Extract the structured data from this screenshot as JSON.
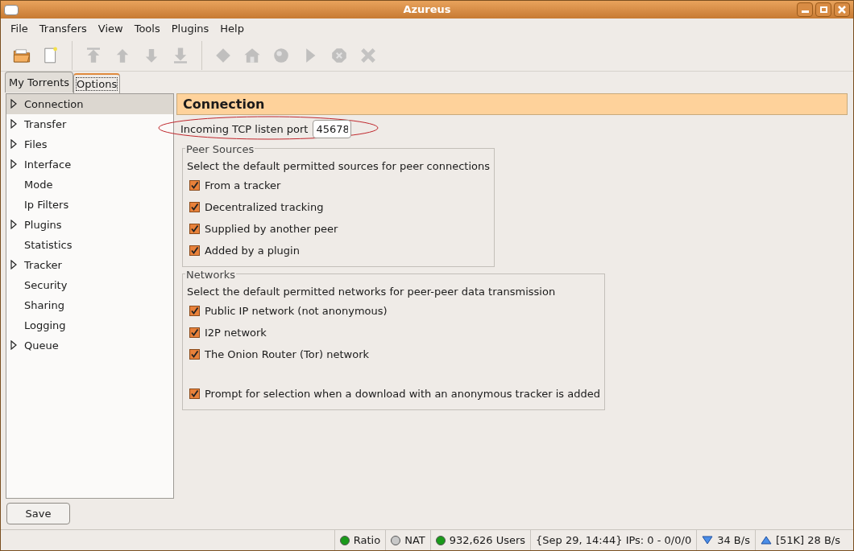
{
  "window": {
    "title": "Azureus"
  },
  "menu": [
    "File",
    "Transfers",
    "View",
    "Tools",
    "Plugins",
    "Help"
  ],
  "toolbar": [
    {
      "kind": "open",
      "disabled": false
    },
    {
      "kind": "new",
      "disabled": false
    },
    {
      "kind": "sep"
    },
    {
      "kind": "top",
      "disabled": true
    },
    {
      "kind": "up",
      "disabled": true
    },
    {
      "kind": "down",
      "disabled": true
    },
    {
      "kind": "bottom",
      "disabled": true
    },
    {
      "kind": "sep"
    },
    {
      "kind": "diamond",
      "disabled": true
    },
    {
      "kind": "house",
      "disabled": true
    },
    {
      "kind": "globe",
      "disabled": true
    },
    {
      "kind": "play",
      "disabled": true
    },
    {
      "kind": "stop",
      "disabled": true
    },
    {
      "kind": "remove",
      "disabled": true
    }
  ],
  "tabs": [
    {
      "label": "My Torrents",
      "selected": false
    },
    {
      "label": "Options",
      "selected": true
    }
  ],
  "sidebar": {
    "items": [
      {
        "label": "Connection",
        "expandable": true,
        "selected": true
      },
      {
        "label": "Transfer",
        "expandable": true,
        "selected": false
      },
      {
        "label": "Files",
        "expandable": true,
        "selected": false
      },
      {
        "label": "Interface",
        "expandable": true,
        "selected": false
      },
      {
        "label": "Mode",
        "expandable": false,
        "selected": false
      },
      {
        "label": "Ip Filters",
        "expandable": false,
        "selected": false
      },
      {
        "label": "Plugins",
        "expandable": true,
        "selected": false
      },
      {
        "label": "Statistics",
        "expandable": false,
        "selected": false
      },
      {
        "label": "Tracker",
        "expandable": true,
        "selected": false
      },
      {
        "label": "Security",
        "expandable": false,
        "selected": false
      },
      {
        "label": "Sharing",
        "expandable": false,
        "selected": false
      },
      {
        "label": "Logging",
        "expandable": false,
        "selected": false
      },
      {
        "label": "Queue",
        "expandable": true,
        "selected": false
      }
    ]
  },
  "panel": {
    "title": "Connection",
    "port": {
      "label": "Incoming TCP listen port",
      "value": "45678"
    },
    "groups": [
      {
        "title": "Peer Sources",
        "description": "Select the default permitted sources for peer connections",
        "options": [
          {
            "kind": "checkbox",
            "label": "From a tracker",
            "checked": true
          },
          {
            "kind": "checkbox",
            "label": "Decentralized tracking",
            "checked": true
          },
          {
            "kind": "checkbox",
            "label": "Supplied by another peer",
            "checked": true
          },
          {
            "kind": "checkbox",
            "label": "Added by a plugin",
            "checked": true
          }
        ]
      },
      {
        "title": "Networks",
        "description": "Select the default permitted networks for peer-peer data transmission",
        "options": [
          {
            "kind": "checkbox",
            "label": "Public IP network (not anonymous)",
            "checked": true
          },
          {
            "kind": "checkbox",
            "label": "I2P network",
            "checked": true
          },
          {
            "kind": "checkbox",
            "label": "The Onion Router (Tor) network",
            "checked": true
          },
          {
            "kind": "spacer"
          },
          {
            "kind": "checkbox",
            "label": "Prompt for selection when a download with an anonymous tracker is added",
            "checked": true
          }
        ]
      }
    ]
  },
  "save_button": "Save",
  "status_bar": [
    {
      "kind": "dot",
      "text": "Ratio",
      "color": "#1a9a1a"
    },
    {
      "kind": "dot",
      "text": "NAT",
      "color": "#c8c8c8"
    },
    {
      "kind": "dot",
      "text": "932,626 Users",
      "color": "#1a9a1a"
    },
    {
      "kind": "text",
      "text": "{Sep 29, 14:44} IPs: 0 - 0/0/0"
    },
    {
      "kind": "down",
      "text": "34 B/s"
    },
    {
      "kind": "up",
      "text": "[51K] 28 B/s"
    }
  ]
}
